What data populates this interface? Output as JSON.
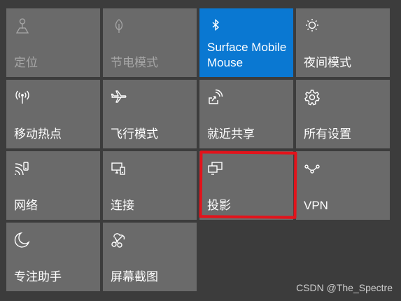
{
  "colors": {
    "panel_bg": "#3c3c3c",
    "tile_bg": "#6a6a6a",
    "tile_active_bg": "#0a78d2",
    "disabled_text": "#a6a6a6",
    "highlight": "#e3131b"
  },
  "tiles": [
    {
      "label": "定位",
      "icon": "location-icon",
      "state": "disabled"
    },
    {
      "label": "节电模式",
      "icon": "battery-saver-icon",
      "state": "disabled"
    },
    {
      "label": "Surface Mobile\nMouse",
      "icon": "bluetooth-icon",
      "state": "active"
    },
    {
      "label": "夜间模式",
      "icon": "night-light-icon",
      "state": "normal"
    },
    {
      "label": "移动热点",
      "icon": "mobile-hotspot-icon",
      "state": "normal"
    },
    {
      "label": "飞行模式",
      "icon": "airplane-icon",
      "state": "normal"
    },
    {
      "label": "就近共享",
      "icon": "nearby-share-icon",
      "state": "normal"
    },
    {
      "label": "所有设置",
      "icon": "gear-icon",
      "state": "normal"
    },
    {
      "label": "网络",
      "icon": "network-icon",
      "state": "normal"
    },
    {
      "label": "连接",
      "icon": "connect-icon",
      "state": "normal"
    },
    {
      "label": "投影",
      "icon": "project-icon",
      "state": "normal",
      "highlighted": true
    },
    {
      "label": "VPN",
      "icon": "vpn-icon",
      "state": "normal"
    },
    {
      "label": "专注助手",
      "icon": "focus-assist-moon-icon",
      "state": "normal"
    },
    {
      "label": "屏幕截图",
      "icon": "screen-snip-icon",
      "state": "normal"
    }
  ],
  "watermark": "CSDN @The_Spectre"
}
